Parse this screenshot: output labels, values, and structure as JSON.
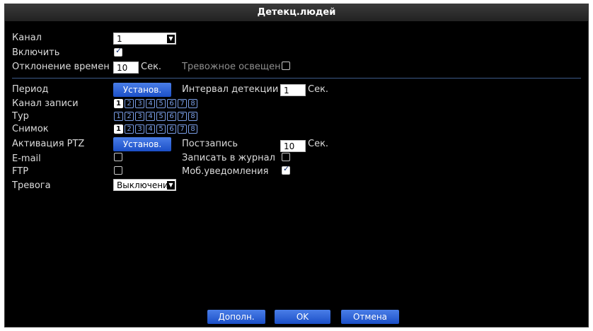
{
  "title": "Детекц.людей",
  "labels": {
    "channel": "Канал",
    "enable": "Включить",
    "deviation": "Отклонение времен",
    "sec": "Сек.",
    "alarm_light": "Тревожное освещен",
    "period": "Период",
    "interval": "Интервал детекции",
    "rec_channel": "Канал записи",
    "tour": "Тур",
    "snapshot": "Снимок",
    "ptz": "Активация PTZ",
    "postrec": "Постзапись",
    "email": "E-mail",
    "log": "Записать в журнал",
    "ftp": "FTP",
    "mobile": "Моб.уведомления",
    "alarm": "Тревога"
  },
  "values": {
    "channel": "1",
    "deviation": "10",
    "interval": "1",
    "postrec": "10",
    "alarm": "Выключени"
  },
  "checks": {
    "enable": true,
    "alarm_light": false,
    "email": false,
    "log": false,
    "ftp": false,
    "mobile": true
  },
  "buttons": {
    "setup": "Установ.",
    "more": "Дополн.",
    "ok": "OK",
    "cancel": "Отмена"
  },
  "channels": [
    "1",
    "2",
    "3",
    "4",
    "5",
    "6",
    "7",
    "8"
  ],
  "channel_selected": {
    "rec_channel": [
      "1"
    ],
    "tour": [],
    "snapshot": [
      "1"
    ]
  }
}
